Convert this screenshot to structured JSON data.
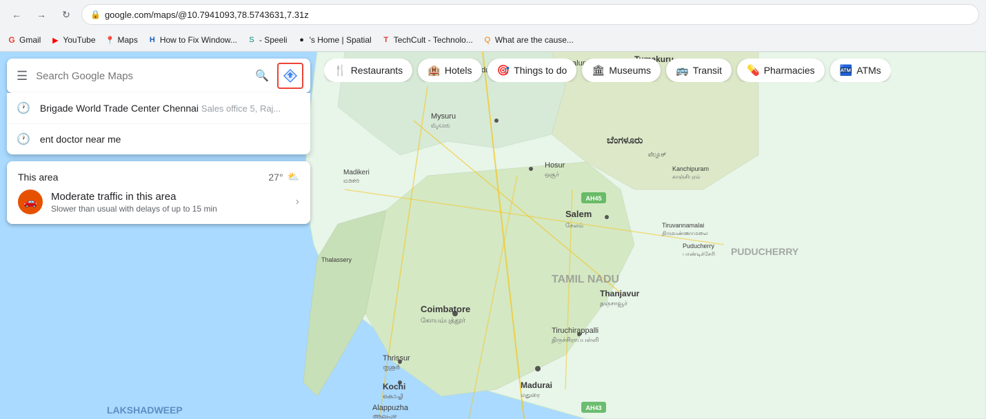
{
  "browser": {
    "url": "google.com/maps/@10.7941093,78.5743631,7.31z",
    "back_label": "←",
    "forward_label": "→",
    "refresh_label": "↻",
    "lock_icon": "🔒",
    "bookmarks": [
      {
        "label": "Gmail",
        "icon": "G",
        "color": "#EA4335"
      },
      {
        "label": "YouTube",
        "icon": "▶",
        "color": "#FF0000"
      },
      {
        "label": "Maps",
        "icon": "📍",
        "color": "#4285F4"
      },
      {
        "label": "How to Fix Window...",
        "icon": "H",
        "color": "#185ABC"
      },
      {
        "label": "- Speeli",
        "icon": "S",
        "color": "#00897B"
      },
      {
        "label": "'s Home | Spatial",
        "icon": "●",
        "color": "#212121"
      },
      {
        "label": "TechCult - Technolo...",
        "icon": "T",
        "color": "#E53935"
      },
      {
        "label": "What are the cause...",
        "icon": "Q",
        "color": "#F57C00"
      }
    ]
  },
  "search": {
    "placeholder": "Search Google Maps",
    "menu_icon": "☰",
    "search_icon": "🔍"
  },
  "autocomplete": {
    "items": [
      {
        "main": "Brigade World Trade Center Chennai",
        "sub": "Sales office 5, Raj..."
      },
      {
        "main": "ent doctor near me",
        "sub": ""
      }
    ]
  },
  "traffic_card": {
    "area_label": "This area",
    "temp": "27°",
    "weather_icon": "⛅",
    "traffic_icon": "🚗",
    "traffic_title": "Moderate traffic in this area",
    "traffic_sub": "Slower than usual with delays of up to 15 min",
    "chevron": "›"
  },
  "categories": [
    {
      "label": "Restaurants",
      "icon": "🍴",
      "active": false
    },
    {
      "label": "Hotels",
      "icon": "🏨",
      "active": false
    },
    {
      "label": "Things to do",
      "icon": "🎯",
      "active": false
    },
    {
      "label": "Museums",
      "icon": "🏛",
      "active": false
    },
    {
      "label": "Transit",
      "icon": "🚌",
      "active": false
    },
    {
      "label": "Pharmacies",
      "icon": "💊",
      "active": false
    },
    {
      "label": "ATMs",
      "icon": "🏧",
      "active": false
    }
  ],
  "colors": {
    "water": "#aadaff",
    "land": "#e8f5e9",
    "road": "#f5c242",
    "text_dark": "#202124",
    "highlight": "#ea4335",
    "directions_btn_border": "#ea4335"
  }
}
